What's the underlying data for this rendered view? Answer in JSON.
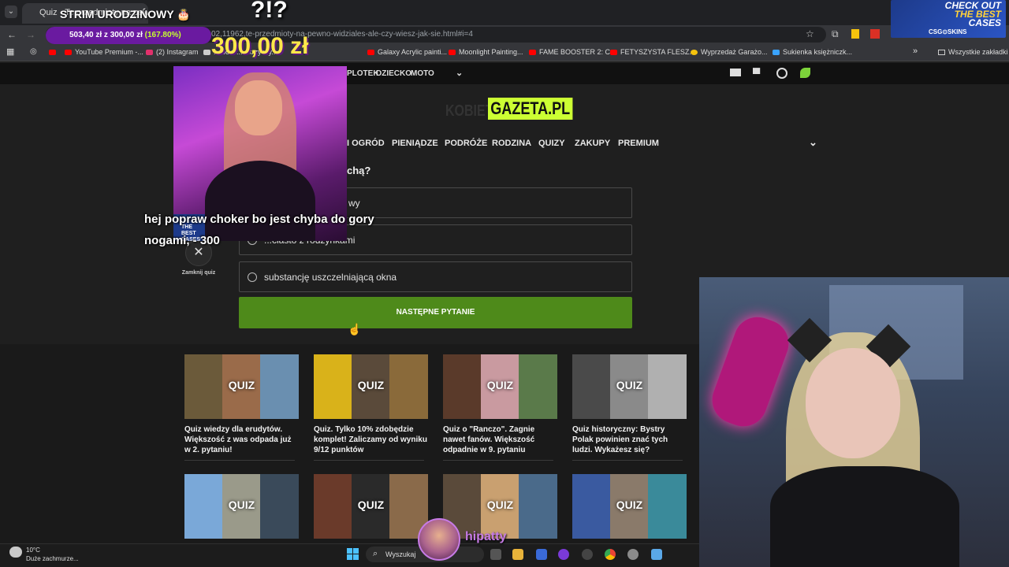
{
  "browser": {
    "tab_title": "Quiz - Te przedmioty na pewno...",
    "url_fragment": "02,11962,te-przedmioty-na-pewno-widziales-ale-czy-wiesz-jak-sie.html#i=4",
    "bookmarks": [
      {
        "label": "YouTube Premium -...",
        "color": "#ff0000"
      },
      {
        "label": "(2) Instagram",
        "color": "#e1306c"
      },
      {
        "label": "... bów ... okrzyscy...",
        "color": "#cccccc"
      },
      {
        "label": "Galaxy Acrylic painti...",
        "color": "#ff0000"
      },
      {
        "label": "Moonlight Painting...",
        "color": "#ff0000"
      },
      {
        "label": "FAME BOOSTER 2: C...",
        "color": "#ff0000"
      },
      {
        "label": "FETYSZYSTA FLESZ...",
        "color": "#ff0000"
      },
      {
        "label": "Wyprzedaż Garażo...",
        "color": "#f4c20d"
      },
      {
        "label": "Sukienka księżniczk...",
        "color": "#3aa3ff"
      }
    ],
    "all_bookmarks": "Wszystkie zakładki"
  },
  "site": {
    "top_nav": [
      "PLOTEK",
      "DZIECKO",
      "MOTO"
    ],
    "logo_left": "KOBIETA",
    "logo_right": "GAZETA.PL",
    "categories": [
      "I OGRÓD",
      "PIENIĄDZE",
      "PODRÓŻE",
      "RODZINA",
      "QUIZY",
      "ZAKUPY",
      "PREMIUM"
    ]
  },
  "quiz": {
    "question_fragment": "chą?",
    "options": [
      "wy",
      "...ciasto z rodzynkami",
      "substancję uszczelniającą okna"
    ],
    "next_button": "NASTĘPNE PYTANIE",
    "close_label": "Zamknij quiz"
  },
  "cards": [
    {
      "title": "Quiz wiedzy dla erudytów. Większość z was odpada już w 2. pytaniu!",
      "badge": "QUIZ",
      "colors": [
        "#6b5a3a",
        "#9a6b4a",
        "#6a8fb0"
      ]
    },
    {
      "title": "Quiz. Tylko 10% zdobędzie komplet! Zaliczamy od wyniku 9/12 punktów",
      "badge": "QUIZ",
      "colors": [
        "#d9b21a",
        "#5a4a3a",
        "#8a6a3a"
      ]
    },
    {
      "title": "Quiz o \"Ranczo\". Zagnie nawet fanów. Większość odpadnie w 9. pytaniu",
      "badge": "QUIZ",
      "colors": [
        "#5a3a2a",
        "#c99aa0",
        "#5a7a4a"
      ]
    },
    {
      "title": "Quiz historyczny: Bystry Polak powinien znać tych ludzi. Wykażesz się?",
      "badge": "QUIZ",
      "colors": [
        "#4a4a4a",
        "#8a8a8a",
        "#b0b0b0"
      ]
    },
    {
      "title": "",
      "badge": "QUIZ",
      "colors": [
        "#7aa8d8",
        "#9a9a8a",
        "#3a4a5a"
      ]
    },
    {
      "title": "",
      "badge": "QUIZ",
      "colors": [
        "#6a3a2a",
        "#2a2a2a",
        "#8a6a4a"
      ]
    },
    {
      "title": "",
      "badge": "QUIZ",
      "colors": [
        "#5a4a3a",
        "#c9a070",
        "#4a6a8a"
      ]
    },
    {
      "title": "",
      "badge": "QUIZ",
      "colors": [
        "#3a5aa0",
        "#8a7a6a",
        "#3a8a9a"
      ]
    }
  ],
  "stream": {
    "title": "STRIM URODZIŃOWY 🎂",
    "question_marks": "?!?",
    "goal_text": "503,40 zł z 300,00 zł",
    "goal_pct": "(167.80%)",
    "goal_progress": 1.0,
    "donation_amount": "300,00 zł",
    "donation_message": "hej popraw choker bo jest chyba do gory nogami, - 300",
    "viewer_name": "hipatty",
    "ad": {
      "line1": "CHECK OUT",
      "line2": "THE BEST",
      "line3": "CASES",
      "brand": "CSG⊙SKINS"
    },
    "ad_small": "THE BEST CASES"
  },
  "taskbar": {
    "temperature": "10°C",
    "weather": "Duże zachmurze...",
    "search_placeholder": "Wyszukaj"
  }
}
